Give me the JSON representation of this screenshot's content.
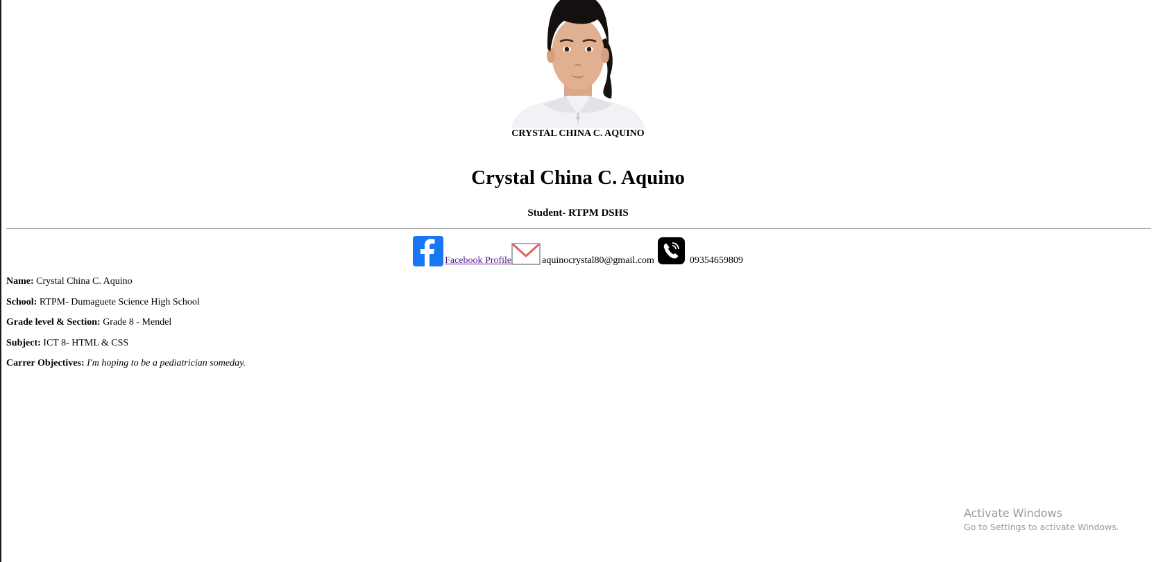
{
  "photo": {
    "caption": "CRYSTAL CHINA C. AQUINO"
  },
  "header": {
    "title": "Crystal China C. Aquino",
    "subtitle": "Student- RTPM DSHS"
  },
  "contacts": {
    "facebook_label": " Facebook Profile ",
    "facebook_icon": "facebook-icon",
    "email": "aquinocrystal80@gmail.com",
    "email_icon": "mail-icon",
    "phone": "09354659809",
    "phone_icon": "phone-icon"
  },
  "details": [
    {
      "label": "Name:",
      "value": " Crystal China C. Aquino"
    },
    {
      "label": "School:",
      "value": " RTPM- Dumaguete Science High School"
    },
    {
      "label": "Grade level & Section:",
      "value": " Grade 8 - Mendel"
    },
    {
      "label": "Subject:",
      "value": " ICT 8- HTML & CSS"
    },
    {
      "label": "Carrer Objectives:",
      "value": "I'm hoping to be a pediatrician someday."
    }
  ],
  "watermark": {
    "line1": "Activate Windows",
    "line2": "Go to Settings to activate Windows."
  },
  "colors": {
    "link": "#551a8b",
    "facebook_blue": "#1877f2",
    "rule": "#9a9a9a",
    "watermark": "#9a9a9a"
  }
}
